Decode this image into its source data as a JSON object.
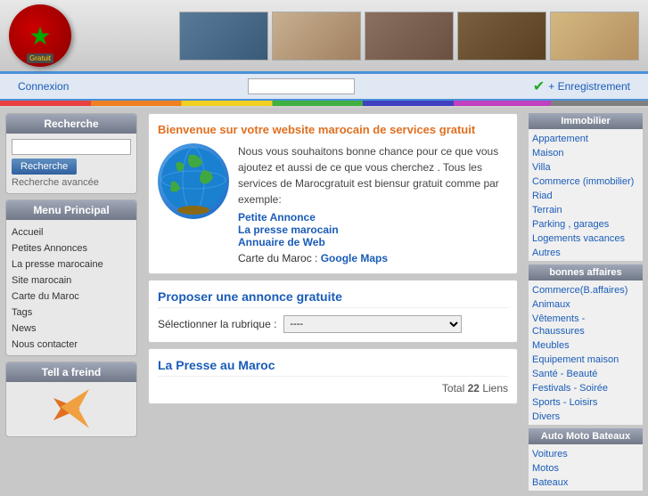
{
  "header": {
    "logo_text": "★",
    "gratuit_label": "Gratuit",
    "connexion_label": "Connexion",
    "enregistrement_label": "+ Enregistrement",
    "login_placeholder": ""
  },
  "sidebar_left": {
    "search_title": "Recherche",
    "search_button": "Recherche",
    "advanced_search": "Recherche avancée",
    "menu_title": "Menu Principal",
    "menu_items": [
      {
        "label": "Accueil",
        "url": "#"
      },
      {
        "label": "Petites Annonces",
        "url": "#"
      },
      {
        "label": "La presse marocaine",
        "url": "#"
      },
      {
        "label": "Site marocain",
        "url": "#"
      },
      {
        "label": "Carte du Maroc",
        "url": "#"
      },
      {
        "label": "Tags",
        "url": "#"
      },
      {
        "label": "News",
        "url": "#"
      },
      {
        "label": "Nous contacter",
        "url": "#"
      }
    ],
    "tell_friend_title": "Tell a freind"
  },
  "welcome": {
    "title": "Bienvenue sur votre website marocain de services gratuit",
    "body": "Nous vous souhaitons bonne chance pour ce que vous ajoutez et aussi de ce que vous cherchez . Tous les services de Marocgratuit est biensur gratuit comme par exemple:",
    "link1": "Petite Annonce",
    "link2": "La presse marocain",
    "link3": "Annuaire de Web",
    "map_label": "Carte du Maroc : ",
    "map_link": "Google Maps"
  },
  "propose": {
    "title": "Proposer une annonce gratuite",
    "rubrique_label": "Sélectionner la rubrique :",
    "rubrique_default": "----"
  },
  "presse": {
    "title": "La Presse au Maroc",
    "total_label": "Total",
    "total_count": "22",
    "total_unit": "Liens"
  },
  "immobilier": {
    "title": "Immobilier",
    "items": [
      "Appartement",
      "Maison",
      "Villa",
      "Commerce (immobilier)",
      "Riad",
      "Terrain",
      "Parking , garages",
      "Logements vacances",
      "Autres"
    ]
  },
  "bonnes_affaires": {
    "title": "bonnes affaires",
    "items": [
      "Commerce(B.affaires)",
      "Animaux",
      "Vêtements - Chaussures",
      "Meubles",
      "Equipement maison",
      "Santé - Beauté",
      "Festivals - Soirée",
      "Sports - Loisirs",
      "Divers"
    ]
  },
  "auto_moto": {
    "title": "Auto Moto Bateaux",
    "items": [
      "Voitures",
      "Motos",
      "Bateaux"
    ]
  }
}
